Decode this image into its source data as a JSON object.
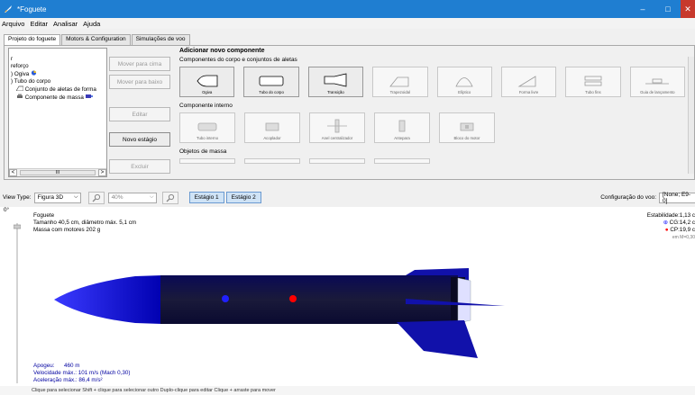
{
  "window": {
    "title": "*Foguete",
    "minimize": "–",
    "maximize": "□",
    "close": "✕"
  },
  "menu": [
    "Arquivo",
    "Editar",
    "Analisar",
    "Ajuda"
  ],
  "tabs": [
    "Projeto do foguete",
    "Motors & Configuration",
    "Simulações de voo"
  ],
  "tree": {
    "items": [
      "r",
      "reforço",
      ") Ogiva",
      ") Tubo do corpo",
      "Conjunto de aletas de forma",
      "Componente de massa"
    ],
    "scroll_thumb": "III",
    "scroll_left": "<",
    "scroll_right": ">"
  },
  "side_buttons": {
    "move_up": "Mover para cima",
    "move_down": "Mover para baixo",
    "edit": "Editar",
    "new_stage": "Novo estágio",
    "delete": "Excluir"
  },
  "add_panel": {
    "header": "Adicionar novo componente",
    "body_section": "Componentes do corpo e conjuntos de aletas",
    "body_components": [
      {
        "label": "Ogiva",
        "icon": "nose-cone-icon"
      },
      {
        "label": "Tubo do corpo",
        "icon": "body-tube-icon"
      },
      {
        "label": "Transição",
        "icon": "transition-icon"
      },
      {
        "label": "Trapezoidal",
        "icon": "trapezoidal-fin-icon"
      },
      {
        "label": "Elíptico",
        "icon": "elliptical-fin-icon"
      },
      {
        "label": "Forma livre",
        "icon": "freeform-fin-icon"
      },
      {
        "label": "Tubo fins",
        "icon": "tube-fins-icon"
      },
      {
        "label": "Guia de lançamento",
        "icon": "launch-lug-icon"
      }
    ],
    "internal_section": "Componente interno",
    "internal_components": [
      {
        "label": "Tubo interno",
        "icon": "inner-tube-icon"
      },
      {
        "label": "Acoplador",
        "icon": "coupler-icon"
      },
      {
        "label": "Anel centralizador",
        "icon": "centering-ring-icon"
      },
      {
        "label": "Antepara",
        "icon": "bulkhead-icon"
      },
      {
        "label": "Bloco do motor",
        "icon": "engine-block-icon"
      }
    ],
    "mass_section": "Objetos de massa"
  },
  "view_bar": {
    "view_type_label": "View Type:",
    "view_type_value": "Figura 3D",
    "zoom_value": "40%",
    "stage1": "Estágio 1",
    "stage2": "Estágio 2",
    "flight_config_label": "Configuração do voo:",
    "flight_config_value": "[None; E9-0]"
  },
  "figure": {
    "slider_value": "0°",
    "rocket_name": "Foguete",
    "size": "Tamanho 40,5 cm, diâmetro máx. 5,1 cm",
    "mass": "Massa com motores 202 g",
    "stability": "Estabilidade:1,13 c",
    "cg": "CG:14,2 c",
    "cp": "CP:19,9 c",
    "mach": "em M=0,30",
    "apogee_label": "Apogeu:",
    "apogee_value": "460 m",
    "max_velocity_label": "Velocidade máx.:",
    "max_velocity_value": "101 m/s  (Mach 0,30)",
    "max_accel_label": "Aceleração máx.:",
    "max_accel_value": "86,4 m/s²"
  },
  "status": "Clique para selecionar    Shift + clique para selecionar outro    Duplo-clique para editar    Clique + arraste para mover",
  "colors": {
    "titlebar": "#1f7ed1",
    "rocket": "#1010c8",
    "cg": "#1a1aff",
    "cp": "#ff0000",
    "stage_btn": "#cfe3f6"
  }
}
